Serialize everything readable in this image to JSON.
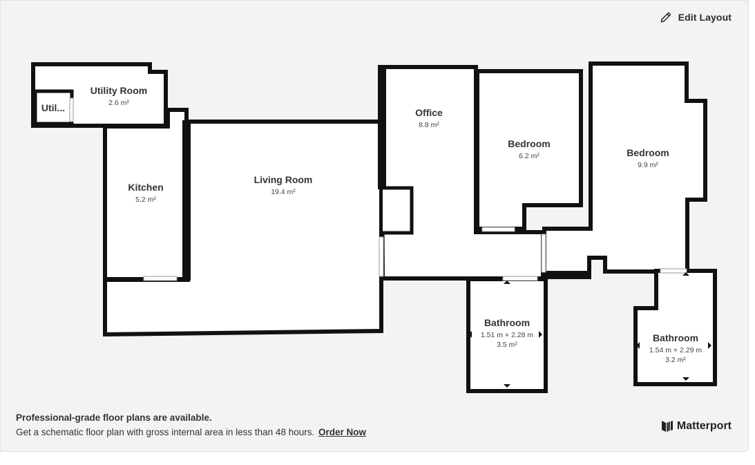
{
  "header": {
    "edit_label": "Edit Layout",
    "edit_icon": "pencil-icon"
  },
  "rooms": [
    {
      "id": "utility-room",
      "name": "Utility Room",
      "area": "2.6 m²"
    },
    {
      "id": "util-closet",
      "name": "Util..."
    },
    {
      "id": "kitchen",
      "name": "Kitchen",
      "area": "5.2 m²"
    },
    {
      "id": "living-room",
      "name": "Living Room",
      "area": "19.4 m²"
    },
    {
      "id": "office",
      "name": "Office",
      "area": "8.8 m²"
    },
    {
      "id": "bedroom-1",
      "name": "Bedroom",
      "area": "6.2 m²"
    },
    {
      "id": "bedroom-2",
      "name": "Bedroom",
      "area": "9.9 m²"
    },
    {
      "id": "bathroom-1",
      "name": "Bathroom",
      "dims": "1.51 m × 2.28 m",
      "area": "3.5 m²"
    },
    {
      "id": "bathroom-2",
      "name": "Bathroom",
      "dims": "1.54 m × 2.29 m",
      "area": "3.2 m²"
    }
  ],
  "footer": {
    "headline": "Professional-grade floor plans are available.",
    "text": "Get a schematic floor plan with gross internal area in less than 48 hours.",
    "link_label": "Order Now"
  },
  "brand": {
    "name": "Matterport",
    "icon": "matterport-logo-icon"
  },
  "colors": {
    "background": "#f4f3f2",
    "wall": "#111111",
    "floor": "#ffffff",
    "text": "#333333"
  }
}
